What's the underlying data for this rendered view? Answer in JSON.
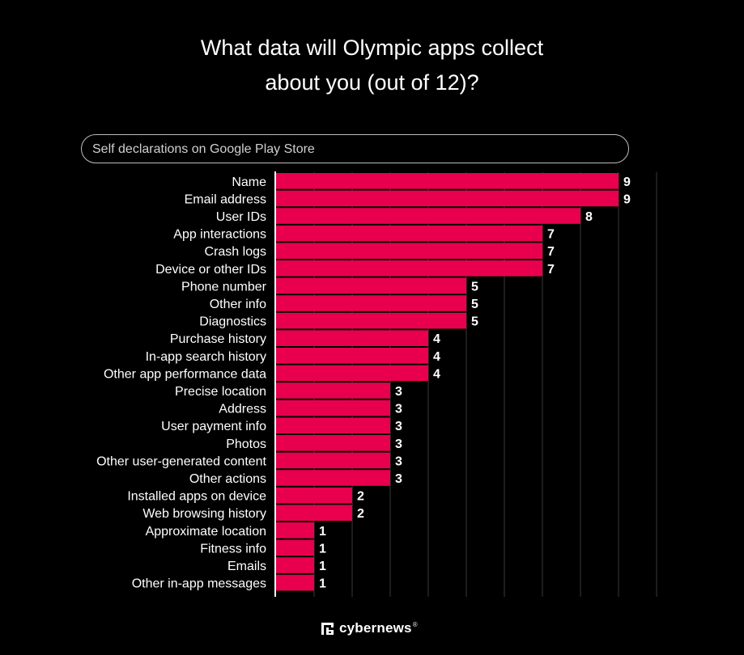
{
  "chart_data": {
    "type": "bar",
    "orientation": "horizontal",
    "title": "What data will Olympic apps collect about you (out of 12)?",
    "title_lines": [
      "What data will Olympic apps collect",
      "about you (out of 12)?"
    ],
    "subtitle": "Self declarations on Google Play Store",
    "xlabel": "",
    "ylabel": "",
    "xlim": [
      0,
      10
    ],
    "grid": true,
    "legend": "none",
    "bar_color": "#E8004F",
    "categories": [
      "Name",
      "Email address",
      "User IDs",
      "App interactions",
      "Crash logs",
      "Device or other IDs",
      "Phone number",
      "Other info",
      "Diagnostics",
      "Purchase history",
      "In-app search history",
      "Other app performance data",
      "Precise location",
      "Address",
      "User payment info",
      "Photos",
      "Other user-generated content",
      "Other actions",
      "Installed apps on device",
      "Web browsing history",
      "Approximate location",
      "Fitness info",
      "Emails",
      "Other in-app messages"
    ],
    "values": [
      9,
      9,
      8,
      7,
      7,
      7,
      5,
      5,
      5,
      4,
      4,
      4,
      3,
      3,
      3,
      3,
      3,
      3,
      2,
      2,
      1,
      1,
      1,
      1
    ]
  },
  "branding": {
    "logo_text": "cybernews",
    "logo_mark": "cybernews-logo-icon",
    "registered": "®"
  }
}
